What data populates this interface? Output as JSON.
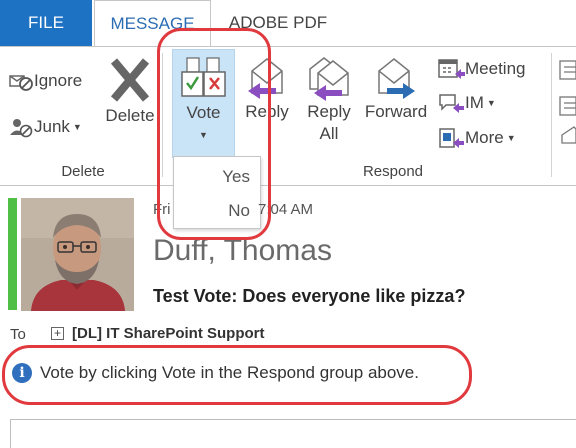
{
  "tabs": [
    {
      "label": "FILE"
    },
    {
      "label": "MESSAGE"
    },
    {
      "label": "ADOBE PDF"
    }
  ],
  "ribbon": {
    "delete_group": {
      "label": "Delete",
      "ignore": "Ignore",
      "junk": "Junk",
      "delete": "Delete"
    },
    "respond_group": {
      "label": "Respond",
      "vote": "Vote",
      "reply": "Reply",
      "reply_all": [
        "Reply",
        "All"
      ],
      "forward": "Forward",
      "meeting": "Meeting",
      "im": "IM",
      "more": "More"
    }
  },
  "vote_menu": {
    "options": [
      "Yes",
      "No"
    ]
  },
  "message": {
    "date_fragment_left": "Fri",
    "date_fragment_right": "7:04 AM",
    "sender": "Duff, Thomas",
    "subject": "Test Vote: Does everyone like pizza?",
    "to_label": "To",
    "recipient": "[DL] IT SharePoint Support",
    "info_text": "Vote by clicking Vote in the Respond group above."
  },
  "colors": {
    "file_tab": "#1e72c3",
    "accent_text": "#2b6cb3",
    "vote_highlight": "#c9e3f7",
    "annotation_red": "#e03a3f",
    "status_green": "#4fbf45",
    "info_icon": "#2f6fbd"
  },
  "icons": [
    "ignore-icon",
    "junk-icon",
    "delete-icon",
    "vote-icon",
    "reply-icon",
    "reply-all-icon",
    "forward-icon",
    "meeting-icon",
    "im-icon",
    "more-icon",
    "info-icon",
    "expand-icon"
  ]
}
